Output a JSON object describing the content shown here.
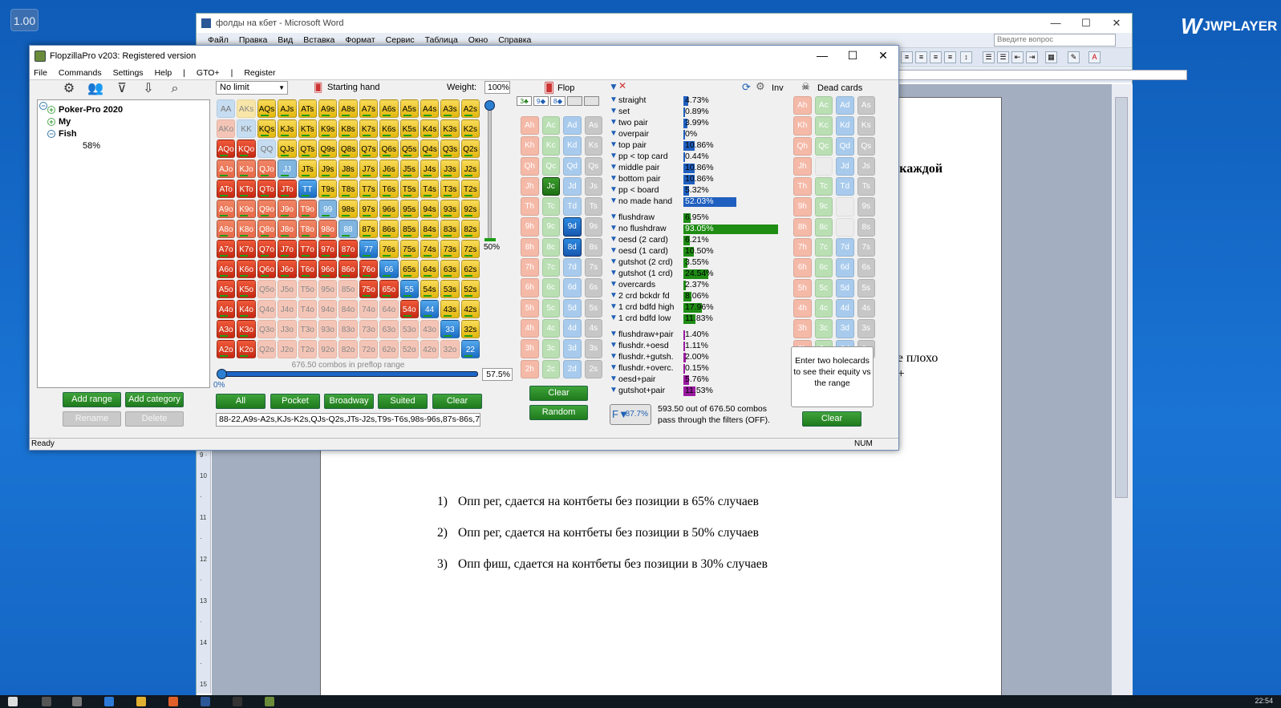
{
  "desktop": {
    "speed_badge": "1.00",
    "jw_label": "JWPLAYER",
    "clock": "22:54"
  },
  "word": {
    "title": "фолды на кбет - Microsoft Word",
    "menu": [
      "Файл",
      "Правка",
      "Вид",
      "Вставка",
      "Формат",
      "Сервис",
      "Таблица",
      "Окно",
      "Справка"
    ],
    "ask_placeholder": "Введите вопрос",
    "ruler_text": "· 15 · · · 16 · · 17 · ·",
    "vruler_text": "9 · 10 · 11 · 12 · 13 · 14 · 15 · 16",
    "page_fragments": {
      "frag1": "на каждой",
      "frag2": "рые плохо",
      "frag3": "ми+"
    },
    "list": [
      {
        "num": "1)",
        "text": "Опп рег, сдается на контбеты без позиции в 65% случаев"
      },
      {
        "num": "2)",
        "text": "Опп рег, сдается на контбеты без позиции в 50% случаев"
      },
      {
        "num": "3)",
        "text": "Опп фиш, сдается на контбеты без позиции в 30% случаев"
      }
    ]
  },
  "flopzilla": {
    "title": "FlopzillaPro v203: Registered version",
    "menu": [
      "File",
      "Commands",
      "Settings",
      "Help",
      "|",
      "GTO+",
      "|",
      "Register"
    ],
    "tree": {
      "root": "Poker-Pro 2020",
      "child1": "My",
      "child2": "Fish",
      "leaf": "58%"
    },
    "buttons": {
      "add_range": "Add range",
      "add_category": "Add category",
      "rename": "Rename",
      "delete": "Delete",
      "all": "All",
      "pocket": "Pocket",
      "broadway": "Broadway",
      "suited": "Suited",
      "clear": "Clear",
      "board_clear": "Clear",
      "random": "Random",
      "dead_clear": "Clear"
    },
    "limit": "No limit",
    "starting_hand": "Starting hand",
    "weight_label": "Weight:",
    "weight_value": "100%",
    "vslider_label": "50%",
    "hslider_left": "0%",
    "hslider_value": "57.5%",
    "hslider_fraction": 0.575,
    "combos_text": "676.50 combos in preflop range",
    "range_text": "88-22,A9s-A2s,KJs-K2s,QJs-Q2s,JTs-J2s,T9s-T6s,98s-96s,87s-86s,7€",
    "flop_label": "Flop",
    "inv_label": "Inv",
    "dead_label": "Dead cards",
    "flop_slots": [
      "3♣",
      "9◆",
      "8◆",
      "",
      ""
    ],
    "enter_text": "Enter two holecards to see their equity vs the range",
    "filter_badge": "87.7%",
    "pass_text1": "593.50 out of 676.50 combos",
    "pass_text2": "pass through the filters (OFF).",
    "status_ready": "Ready",
    "status_num": "NUM",
    "stats": [
      {
        "label": "straight",
        "value": "4.73%",
        "pct": 4.73,
        "group": "made"
      },
      {
        "label": "set",
        "value": "0.89%",
        "pct": 0.89,
        "group": "made"
      },
      {
        "label": "two pair",
        "value": "3.99%",
        "pct": 3.99,
        "group": "made"
      },
      {
        "label": "overpair",
        "value": "0%",
        "pct": 0,
        "group": "made"
      },
      {
        "label": "top pair",
        "value": "10.86%",
        "pct": 10.86,
        "group": "made"
      },
      {
        "label": "pp < top card",
        "value": "0.44%",
        "pct": 0.44,
        "group": "made"
      },
      {
        "label": "middle pair",
        "value": "10.86%",
        "pct": 10.86,
        "group": "made"
      },
      {
        "label": "bottom pair",
        "value": "10.86%",
        "pct": 10.86,
        "group": "made"
      },
      {
        "label": "pp < board",
        "value": "5.32%",
        "pct": 5.32,
        "group": "made"
      },
      {
        "label": "no made hand",
        "value": "52.03%",
        "pct": 52.03,
        "group": "made"
      },
      {
        "label": "flushdraw",
        "value": "6.95%",
        "pct": 6.95,
        "group": "draw"
      },
      {
        "label": "no flushdraw",
        "value": "93.05%",
        "pct": 93.05,
        "group": "draw"
      },
      {
        "label": "oesd (2 card)",
        "value": "6.21%",
        "pct": 6.21,
        "group": "draw"
      },
      {
        "label": "oesd (1 card)",
        "value": "10.50%",
        "pct": 10.5,
        "group": "draw"
      },
      {
        "label": "gutshot (2 crd)",
        "value": "3.55%",
        "pct": 3.55,
        "group": "draw"
      },
      {
        "label": "gutshot (1 crd)",
        "value": "24.54%",
        "pct": 24.54,
        "group": "draw"
      },
      {
        "label": "overcards",
        "value": "2.37%",
        "pct": 2.37,
        "group": "draw"
      },
      {
        "label": "2 crd bckdr fd",
        "value": "8.06%",
        "pct": 8.06,
        "group": "draw"
      },
      {
        "label": "1 crd bdfd high",
        "value": "17.96%",
        "pct": 17.96,
        "group": "draw"
      },
      {
        "label": "1 crd bdfd low",
        "value": "11.83%",
        "pct": 11.83,
        "group": "draw"
      },
      {
        "label": "flushdraw+pair",
        "value": "1.40%",
        "pct": 1.4,
        "group": "combo"
      },
      {
        "label": "flushdr.+oesd",
        "value": "1.11%",
        "pct": 1.11,
        "group": "combo"
      },
      {
        "label": "flushdr.+gutsh.",
        "value": "2.00%",
        "pct": 2.0,
        "group": "combo"
      },
      {
        "label": "flushdr.+overc.",
        "value": "0.15%",
        "pct": 0.15,
        "group": "combo"
      },
      {
        "label": "oesd+pair",
        "value": "5.76%",
        "pct": 5.76,
        "group": "combo"
      },
      {
        "label": "gutshot+pair",
        "value": "11.53%",
        "pct": 11.53,
        "group": "combo"
      }
    ],
    "grid": [
      [
        "AA:dimp",
        "AKs:dims",
        "AQs:s",
        "AJs:s",
        "ATs:s",
        "A9s:s",
        "A8s:s",
        "A7s:s",
        "A6s:s",
        "A5s:s",
        "A4s:s",
        "A3s:s",
        "A2s:s"
      ],
      [
        "AKo:dim",
        "KK:dimp",
        "KQs:s",
        "KJs:s",
        "KTs:s",
        "K9s:s",
        "K8s:s",
        "K7s:s",
        "K6s:s",
        "K5s:s",
        "K4s:s",
        "K3s:s",
        "K2s:s"
      ],
      [
        "AQo:o",
        "KQo:o",
        "QQ:dimp",
        "QJs:s",
        "QTs:s",
        "Q9s:s",
        "Q8s:s",
        "Q7s:s",
        "Q6s:s",
        "Q5s:s",
        "Q4s:s",
        "Q3s:s",
        "Q2s:s"
      ],
      [
        "AJo:os",
        "KJo:os",
        "QJo:os",
        "JJ:ps",
        "JTs:s",
        "J9s:s",
        "J8s:s",
        "J7s:s",
        "J6s:s",
        "J5s:s",
        "J4s:s",
        "J3s:s",
        "J2s:s"
      ],
      [
        "ATo:o",
        "KTo:o",
        "QTo:o",
        "JTo:o",
        "TT:p",
        "T9s:s",
        "T8s:s",
        "T7s:s",
        "T6s:s",
        "T5s:s",
        "T4s:s",
        "T3s:s",
        "T2s:s"
      ],
      [
        "A9o:os",
        "K9o:os",
        "Q9o:os",
        "J9o:os",
        "T9o:os",
        "99:ps",
        "98s:s",
        "97s:s",
        "96s:s",
        "95s:s",
        "94s:s",
        "93s:s",
        "92s:s"
      ],
      [
        "A8o:os",
        "K8o:os",
        "Q8o:os",
        "J8o:os",
        "T8o:os",
        "98o:os",
        "88:ps",
        "87s:s",
        "86s:s",
        "85s:s",
        "84s:s",
        "83s:s",
        "82s:s"
      ],
      [
        "A7o:o",
        "K7o:o",
        "Q7o:o",
        "J7o:o",
        "T7o:o",
        "97o:o",
        "87o:o",
        "77:p",
        "76s:s",
        "75s:s",
        "74s:s",
        "73s:s",
        "72s:s"
      ],
      [
        "A6o:o",
        "K6o:o",
        "Q6o:o",
        "J6o:o",
        "T6o:o",
        "96o:o",
        "86o:o",
        "76o:o",
        "66:p",
        "65s:s",
        "64s:s",
        "63s:s",
        "62s:s"
      ],
      [
        "A5o:o",
        "K5o:o",
        "Q5o:dim",
        "J5o:dim",
        "T5o:dim",
        "95o:dim",
        "85o:dim",
        "75o:o",
        "65o:o",
        "55:p",
        "54s:s",
        "53s:s",
        "52s:s"
      ],
      [
        "A4o:o",
        "K4o:o",
        "Q4o:dim",
        "J4o:dim",
        "T4o:dim",
        "94o:dim",
        "84o:dim",
        "74o:dim",
        "64o:dim",
        "54o:o",
        "44:p",
        "43s:s",
        "42s:s"
      ],
      [
        "A3o:o",
        "K3o:o",
        "Q3o:dim",
        "J3o:dim",
        "T3o:dim",
        "93o:dim",
        "83o:dim",
        "73o:dim",
        "63o:dim",
        "53o:dim",
        "43o:dim",
        "33:p",
        "32s:s"
      ],
      [
        "A2o:o",
        "K2o:o",
        "Q2o:dim",
        "J2o:dim",
        "T2o:dim",
        "92o:dim",
        "82o:dim",
        "72o:dim",
        "62o:dim",
        "52o:dim",
        "42o:dim",
        "32o:dim",
        "22:p"
      ]
    ],
    "board": [
      [
        "Ah:h",
        "Ac:c",
        "Ad:d",
        "As:sp"
      ],
      [
        "Kh:h",
        "Kc:c",
        "Kd:d",
        "Ks:sp"
      ],
      [
        "Qh:h",
        "Qc:c",
        "Qd:d",
        "Qs:sp"
      ],
      [
        "Jh:h",
        "Jc:c sel",
        "Jd:d",
        "Js:sp"
      ],
      [
        "Th:h",
        "Tc:c",
        "Td:d",
        "Ts:sp"
      ],
      [
        "9h:h",
        "9c:c",
        "9d:d sel",
        "9s:sp"
      ],
      [
        "8h:h",
        "8c:c",
        "8d:d sel",
        "8s:sp"
      ],
      [
        "7h:h",
        "7c:c",
        "7d:d",
        "7s:sp"
      ],
      [
        "6h:h",
        "6c:c",
        "6d:d",
        "6s:sp"
      ],
      [
        "5h:h",
        "5c:c",
        "5d:d",
        "5s:sp"
      ],
      [
        "4h:h",
        "4c:c",
        "4d:d",
        "4s:sp"
      ],
      [
        "3h:h",
        "3c:c",
        "3d:d",
        "3s:sp"
      ],
      [
        "2h:h",
        "2c:c",
        "2d:d",
        "2s:sp"
      ]
    ],
    "deadcards": [
      [
        "Ah:h",
        "Ac:c",
        "Ad:d",
        "As:sp"
      ],
      [
        "Kh:h",
        "Kc:c",
        "Kd:d",
        "Ks:sp"
      ],
      [
        "Qh:h",
        "Qc:c",
        "Qd:d",
        "Qs:sp"
      ],
      [
        "Jh:h",
        ":blank",
        "Jd:d",
        "Js:sp"
      ],
      [
        "Th:h",
        "Tc:c",
        "Td:d",
        "Ts:sp"
      ],
      [
        "9h:h",
        "9c:c",
        ":blank",
        "9s:sp"
      ],
      [
        "8h:h",
        "8c:c",
        ":blank",
        "8s:sp"
      ],
      [
        "7h:h",
        "7c:c",
        "7d:d",
        "7s:sp"
      ],
      [
        "6h:h",
        "6c:c",
        "6d:d",
        "6s:sp"
      ],
      [
        "5h:h",
        "5c:c",
        "5d:d",
        "5s:sp"
      ],
      [
        "4h:h",
        "4c:c",
        "4d:d",
        "4s:sp"
      ],
      [
        "3h:h",
        "3c:c",
        "3d:d",
        "3s:sp"
      ],
      [
        "2h:h",
        "2c:c",
        "2d:d",
        "2s:sp"
      ]
    ],
    "colors": {
      "suited": "#f0c72a",
      "offsuit": "#d8341c",
      "pair": "#1f6fc8",
      "made_bar": "#1f5fbf",
      "draw_bar": "#1f8c14",
      "combo_bar": "#9a1aa0"
    }
  }
}
